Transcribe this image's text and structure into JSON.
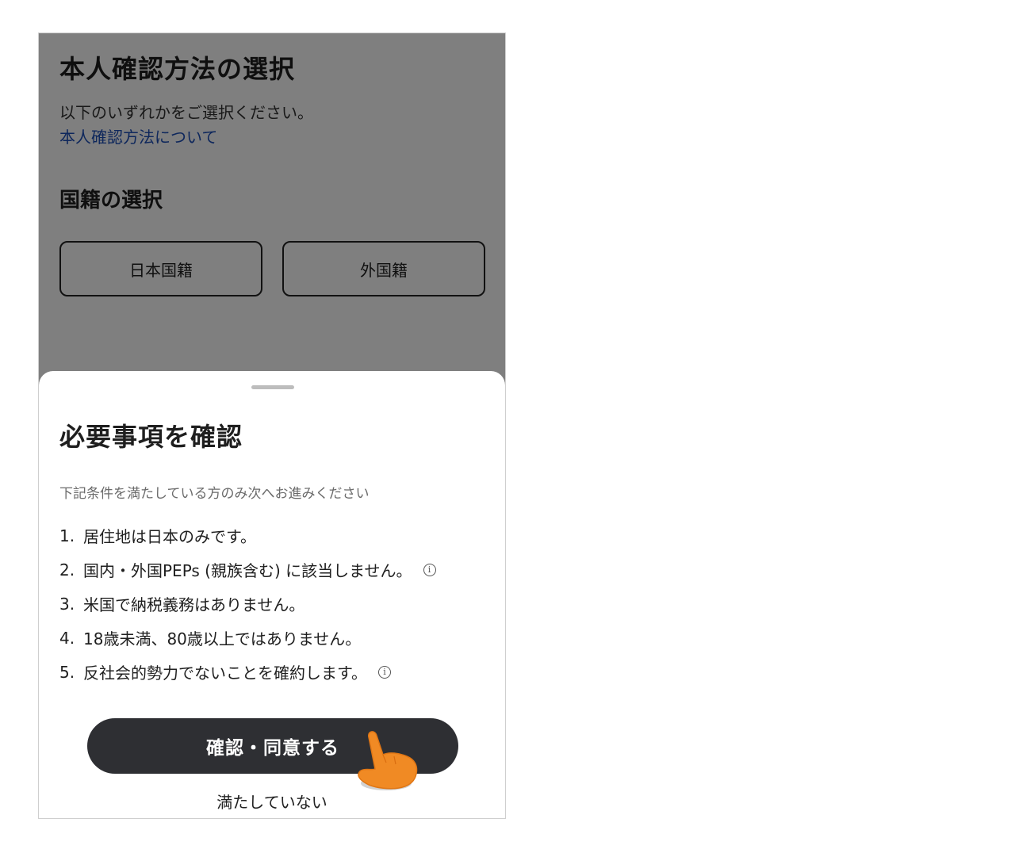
{
  "background_page": {
    "title": "本人確認方法の選択",
    "subtitle": "以下のいずれかをご選択ください。",
    "link": "本人確認方法について",
    "section_title": "国籍の選択",
    "options": [
      "日本国籍",
      "外国籍"
    ]
  },
  "sheet": {
    "title": "必要事項を確認",
    "note": "下記条件を満たしている方のみ次へお進みください",
    "conditions": [
      {
        "num": "1.",
        "text": "居住地は日本のみです。"
      },
      {
        "num": "2.",
        "text": "国内・外国PEPs (親族含む) に該当しません。",
        "info_icon": "i"
      },
      {
        "num": "3.",
        "text": "米国で納税義務はありません。"
      },
      {
        "num": "4.",
        "text": "18歳未満、80歳以上ではありません。"
      },
      {
        "num": "5.",
        "text": "反社会的勢力でないことを確約します。",
        "info_icon": "i"
      }
    ],
    "confirm_button": "確認・同意する",
    "decline_link": "満たしていない"
  },
  "colors": {
    "overlay": "rgba(0,0,0,0.5)",
    "link": "#1d4fb8",
    "primary_button": "#2e2f33",
    "pointer_hand": "#f08a24"
  },
  "icons": {
    "info": "info-icon",
    "pointer": "pointing-hand-icon"
  }
}
